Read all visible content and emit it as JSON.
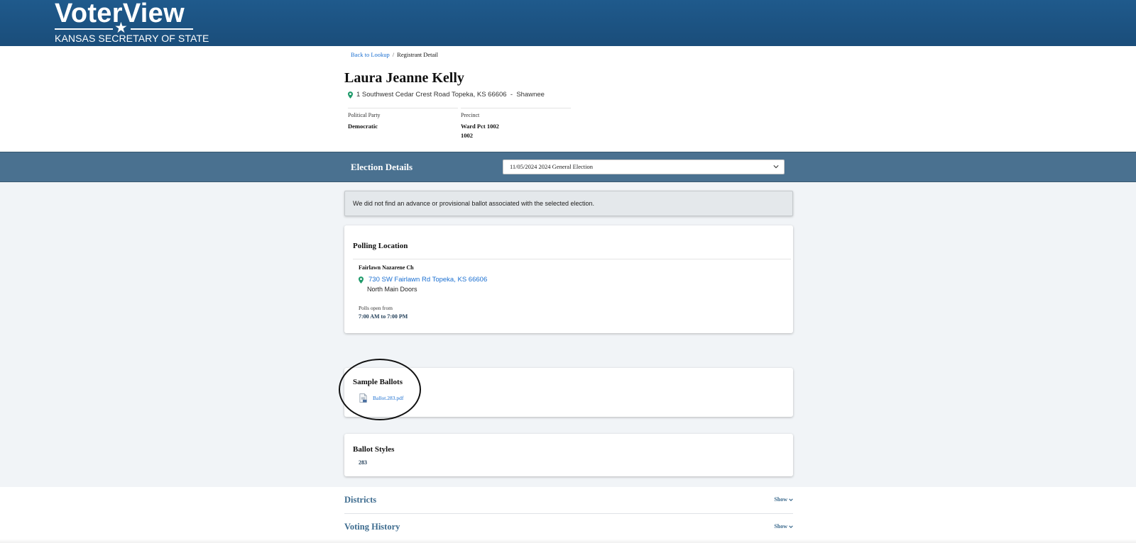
{
  "header": {
    "logo_title": "VoterView",
    "logo_subtitle": "KANSAS SECRETARY OF STATE"
  },
  "breadcrumb": {
    "back_label": "Back to Lookup",
    "separator": "/",
    "current": "Registrant Detail"
  },
  "registrant": {
    "name": "Laura Jeanne Kelly",
    "address": "1 Southwest Cedar Crest Road Topeka, KS 66606  -  Shawnee",
    "party_label": "Political Party",
    "party_value": "Democratic",
    "precinct_label": "Precinct",
    "precinct_line1": "Ward Pct 1002",
    "precinct_line2": "1002"
  },
  "election": {
    "title": "Election Details",
    "selected": "11/05/2024 2024 General Election"
  },
  "notice": "We did not find an advance or provisional ballot associated with the selected election.",
  "polling": {
    "title": "Polling Location",
    "name": "Fairlawn Nazarene Ch",
    "address": "730 SW Fairlawn Rd Topeka, KS 66606",
    "note": "North Main Doors",
    "hours_label": "Polls open from",
    "hours": "7:00 AM to 7:00 PM"
  },
  "sample_ballots": {
    "title": "Sample Ballots",
    "file": "Ballot.283.pdf"
  },
  "ballot_styles": {
    "title": "Ballot Styles",
    "value": "283"
  },
  "sections": {
    "districts": "Districts",
    "voting_history": "Voting History",
    "show_label": "Show"
  },
  "colors": {
    "header": "#1f5a8c",
    "election_bar": "#4a7190",
    "link": "#1a6fd1",
    "pin": "#1f9a6a",
    "content_bg": "#f1f4f7"
  },
  "icons": [
    "map-pin-icon",
    "chevron-down-icon",
    "pdf-file-icon",
    "star-icon"
  ]
}
